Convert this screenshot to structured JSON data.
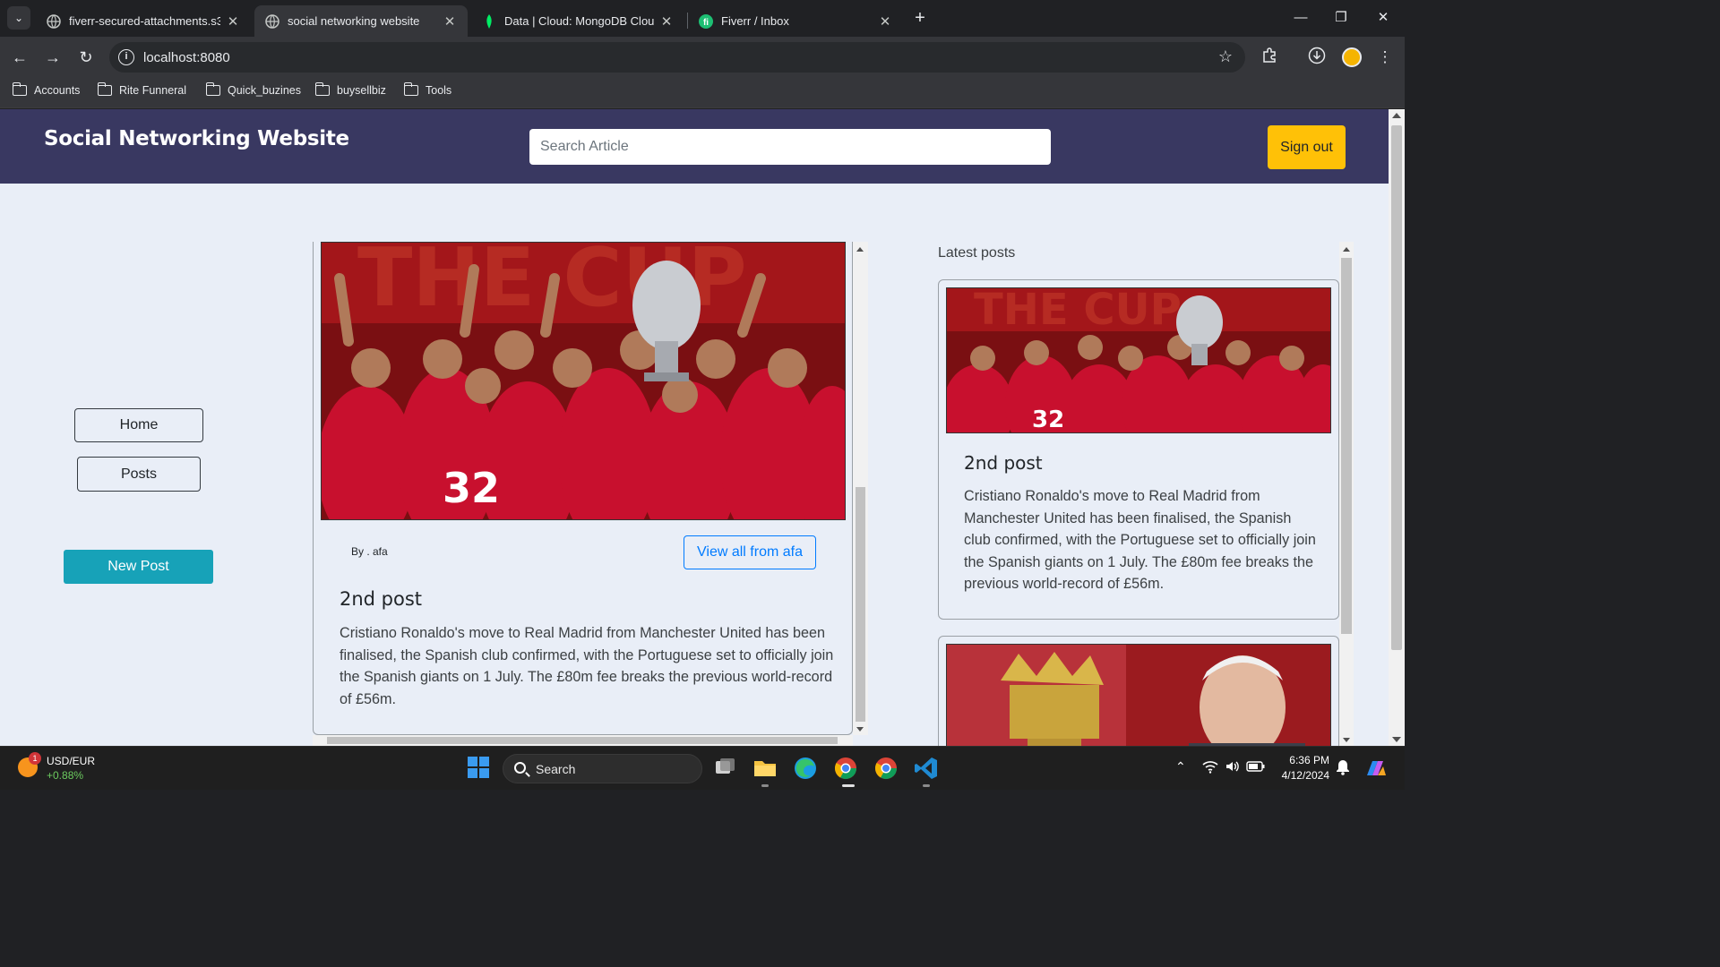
{
  "browser": {
    "tabs": [
      {
        "title": "fiverr-secured-attachments.s3.",
        "active": false
      },
      {
        "title": "social networking website",
        "active": true
      },
      {
        "title": "Data | Cloud: MongoDB Cloud",
        "active": false
      },
      {
        "title": "Fiverr / Inbox",
        "active": false
      }
    ],
    "url": "localhost:8080",
    "bookmarks": [
      "Accounts",
      "Rite Funneral",
      "Quick_buzines",
      "buysellbiz",
      "Tools"
    ]
  },
  "navbar": {
    "brand": "Social Networking Website",
    "search_placeholder": "Search Article",
    "signout_label": "Sign out"
  },
  "sidebar": {
    "home_label": "Home",
    "posts_label": "Posts",
    "new_post_label": "New Post"
  },
  "feed": {
    "byline": "By . afa",
    "view_all_label": "View all from afa",
    "post_title": "2nd post",
    "post_body": "Cristiano Ronaldo's move to Real Madrid from Manchester United has been finalised, the Spanish club confirmed, with the Portuguese set to officially join the Spanish giants on 1 July. The £80m fee breaks the previous world-record of £56m."
  },
  "latest": {
    "heading": "Latest posts",
    "posts": [
      {
        "title": "2nd post",
        "body": "Cristiano Ronaldo's move to Real Madrid from Manchester United has been finalised, the Spanish club confirmed, with the Portuguese set to officially join the Spanish giants on 1 July. The £80m fee breaks the previous world-record of £56m."
      }
    ]
  },
  "taskbar": {
    "ticker_name": "USD/EUR",
    "ticker_change": "+0.88%",
    "ticker_badge": "1",
    "search_label": "Search",
    "time": "6:36 PM",
    "date": "4/12/2024"
  },
  "colors": {
    "navbar_bg": "#393861",
    "page_bg": "#e9eef7",
    "signout_bg": "#ffc107",
    "new_post_bg": "#17a2b8",
    "link_blue": "#007bff"
  }
}
